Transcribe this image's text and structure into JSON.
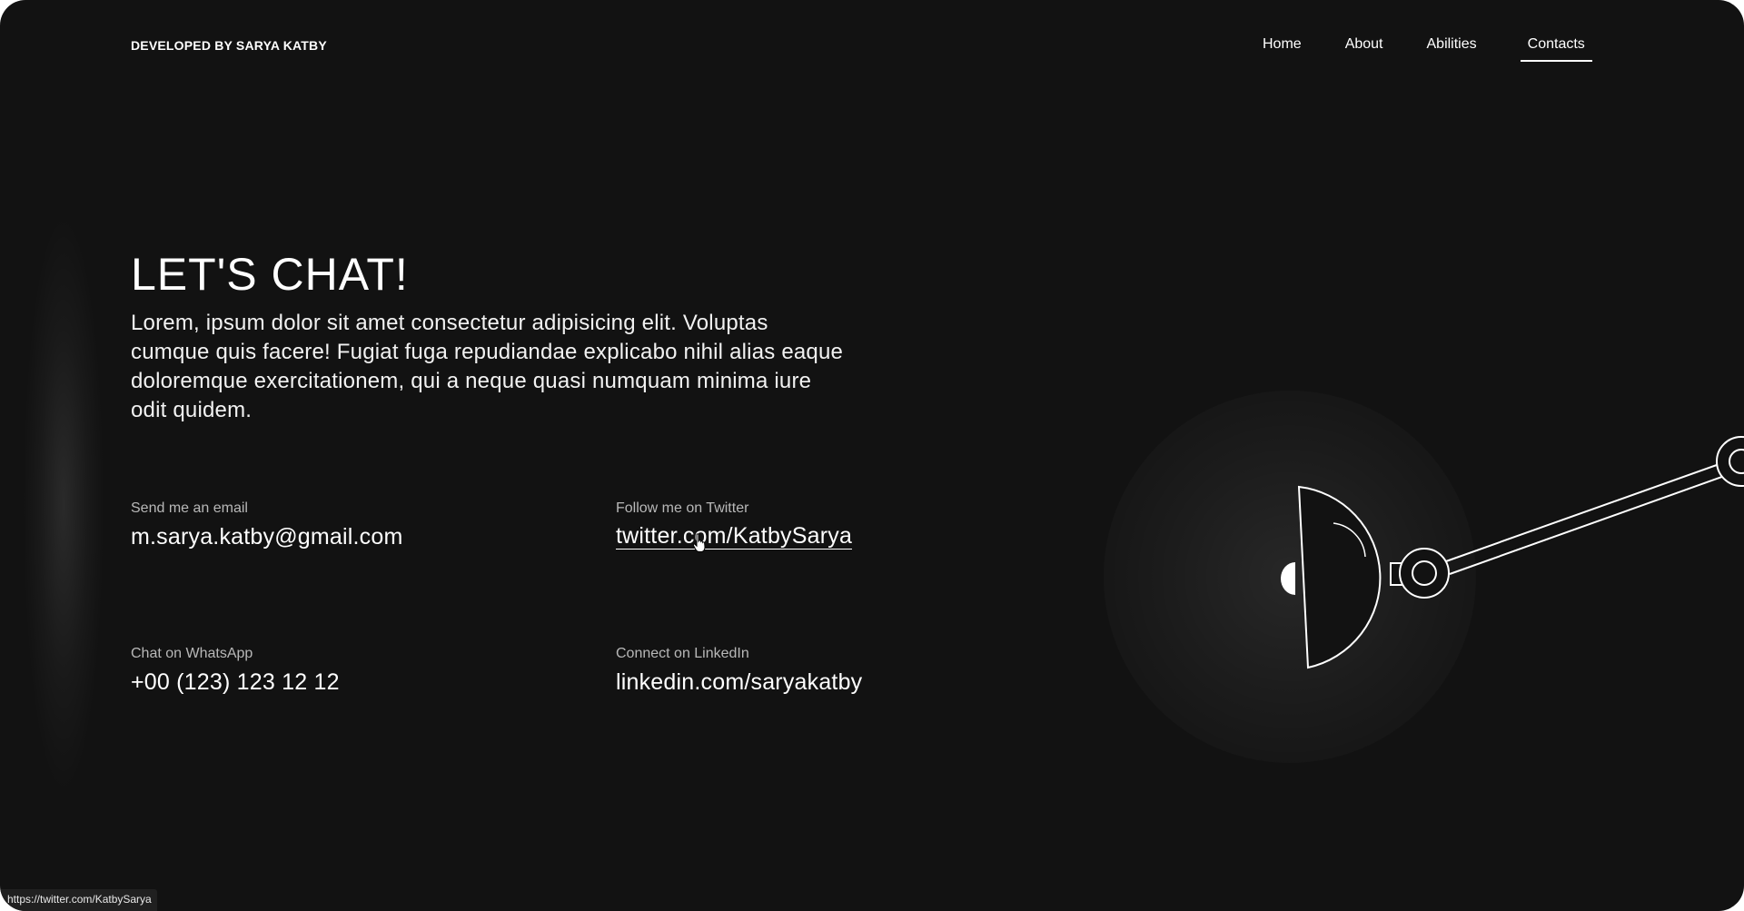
{
  "brand": "DEVELOPED BY SARYA KATBY",
  "nav": {
    "items": [
      "Home",
      "About",
      "Abilities",
      "Contacts"
    ],
    "active": "Contacts"
  },
  "hero": {
    "title": "LET'S CHAT!",
    "text": "Lorem, ipsum dolor sit amet consectetur adipisicing elit. Voluptas cumque quis facere! Fugiat fuga repudiandae explicabo nihil alias eaque doloremque exercitationem, qui a neque quasi numquam minima iure odit quidem."
  },
  "contacts": {
    "email": {
      "label": "Send me an email",
      "value": "m.sarya.katby@gmail.com"
    },
    "twitter": {
      "label": "Follow me on Twitter",
      "value": "twitter.com/KatbySarya"
    },
    "whatsapp": {
      "label": "Chat on WhatsApp",
      "value": "+00 (123) 123 12 12"
    },
    "linkedin": {
      "label": "Connect on LinkedIn",
      "value": "linkedin.com/saryakatby"
    }
  },
  "status_bar": {
    "url": "https://twitter.com/KatbySarya"
  },
  "icons": {
    "lamp": "desk-lamp-illustration",
    "cursor": "hand-pointer-cursor"
  },
  "colors": {
    "background": "#121212",
    "text": "#ffffff",
    "muted": "#b8b8b8"
  }
}
